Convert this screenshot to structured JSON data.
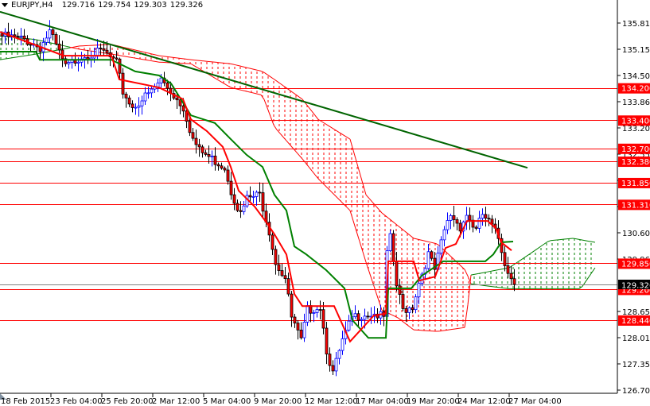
{
  "header": {
    "symbol": "EURJPY,H4",
    "open": "129.716",
    "high": "129.754",
    "low": "129.303",
    "close": "129.326"
  },
  "colors": {
    "bull": "#0000ff",
    "bear_body": "#ff0000",
    "bear_wick": "#000000",
    "tenkan": "#ff0000",
    "kijun": "#008000",
    "cloud_bear": "#ff0000",
    "cloud_bull": "#008000",
    "trendline": "#006400",
    "level": "#ff0000",
    "bid_line": "#808080"
  },
  "chart_data": {
    "type": "candlestick",
    "title": "EURJPY,H4",
    "ylim": [
      126.705,
      135.81
    ],
    "bar_interval": "H4",
    "y_ticks": [
      "135.810",
      "135.150",
      "134.505",
      "133.860",
      "133.200",
      "132.555",
      "131.915",
      "131.250",
      "130.605",
      "129.960",
      "128.655",
      "128.010",
      "127.350",
      "126.705"
    ],
    "x_ticks": [
      {
        "bar": 0,
        "label": "18 Feb 2015"
      },
      {
        "bar": 16,
        "label": "23 Feb 04:00"
      },
      {
        "bar": 32,
        "label": "25 Feb 20:00"
      },
      {
        "bar": 48,
        "label": "2 Mar 12:00"
      },
      {
        "bar": 64,
        "label": "5 Mar 04:00"
      },
      {
        "bar": 80,
        "label": "9 Mar 20:00"
      },
      {
        "bar": 96,
        "label": "12 Mar 12:00"
      },
      {
        "bar": 112,
        "label": "17 Mar 04:00"
      },
      {
        "bar": 128,
        "label": "19 Mar 20:00"
      },
      {
        "bar": 144,
        "label": "24 Mar 12:00"
      },
      {
        "bar": 160,
        "label": "27 Mar 04:00"
      }
    ],
    "close_path": [
      [
        0,
        135.49
      ],
      [
        7,
        135.4
      ],
      [
        12,
        135.2
      ],
      [
        15,
        135.59
      ],
      [
        20,
        134.71
      ],
      [
        25,
        135.0
      ],
      [
        32,
        135.1
      ],
      [
        36,
        134.8
      ],
      [
        38,
        134.11
      ],
      [
        41,
        133.72
      ],
      [
        47,
        134.11
      ],
      [
        50,
        134.41
      ],
      [
        54,
        134.02
      ],
      [
        57,
        133.72
      ],
      [
        60,
        132.93
      ],
      [
        62,
        132.64
      ],
      [
        66,
        132.44
      ],
      [
        70,
        132.24
      ],
      [
        72,
        131.65
      ],
      [
        75,
        131.06
      ],
      [
        77,
        131.45
      ],
      [
        81,
        131.55
      ],
      [
        84,
        130.66
      ],
      [
        86,
        129.88
      ],
      [
        89,
        129.48
      ],
      [
        91,
        128.5
      ],
      [
        94,
        127.91
      ],
      [
        96,
        128.69
      ],
      [
        100,
        128.79
      ],
      [
        102,
        127.71
      ],
      [
        104,
        127.12
      ],
      [
        107,
        127.91
      ],
      [
        110,
        128.5
      ],
      [
        114,
        128.6
      ],
      [
        117,
        128.6
      ],
      [
        120,
        128.5
      ],
      [
        121,
        130.07
      ],
      [
        122,
        130.47
      ],
      [
        124,
        129.29
      ],
      [
        126,
        128.69
      ],
      [
        129,
        128.79
      ],
      [
        131,
        129.38
      ],
      [
        134,
        130.07
      ],
      [
        136,
        129.68
      ],
      [
        139,
        130.66
      ],
      [
        141,
        131.06
      ],
      [
        144,
        130.76
      ],
      [
        146,
        131.06
      ],
      [
        149,
        130.66
      ],
      [
        151,
        131.06
      ],
      [
        154,
        130.76
      ],
      [
        156,
        130.47
      ],
      [
        158,
        129.88
      ],
      [
        160,
        129.48
      ],
      [
        161,
        129.33
      ]
    ],
    "tenkan": [
      [
        0,
        135.59
      ],
      [
        10,
        135.3
      ],
      [
        20,
        135.0
      ],
      [
        35,
        135.0
      ],
      [
        37.5,
        134.41
      ],
      [
        50,
        134.21
      ],
      [
        57.5,
        133.92
      ],
      [
        60,
        133.42
      ],
      [
        65,
        133.13
      ],
      [
        70,
        132.74
      ],
      [
        72.5,
        132.24
      ],
      [
        75,
        131.65
      ],
      [
        80,
        131.26
      ],
      [
        83.75,
        130.86
      ],
      [
        86.25,
        130.57
      ],
      [
        90,
        130.07
      ],
      [
        92.5,
        129.09
      ],
      [
        95,
        128.79
      ],
      [
        105,
        128.79
      ],
      [
        110,
        127.91
      ],
      [
        117.5,
        128.56
      ],
      [
        121.25,
        128.6
      ],
      [
        122,
        129.9
      ],
      [
        130,
        129.9
      ],
      [
        131.75,
        129.42
      ],
      [
        136.75,
        129.52
      ],
      [
        140,
        130.23
      ],
      [
        143.25,
        130.33
      ],
      [
        146.75,
        130.9
      ],
      [
        153.25,
        130.9
      ],
      [
        155.75,
        130.72
      ],
      [
        157.5,
        130.37
      ],
      [
        160.75,
        130.17
      ]
    ],
    "kijun": [
      [
        0,
        135.1
      ],
      [
        11.25,
        135.1
      ],
      [
        12.5,
        134.9
      ],
      [
        35,
        134.9
      ],
      [
        42.5,
        134.61
      ],
      [
        50,
        134.51
      ],
      [
        53.75,
        134.31
      ],
      [
        60,
        133.52
      ],
      [
        67.5,
        133.33
      ],
      [
        72.5,
        132.93
      ],
      [
        77.5,
        132.54
      ],
      [
        82.5,
        132.24
      ],
      [
        86.25,
        131.55
      ],
      [
        90,
        131.16
      ],
      [
        92.5,
        130.27
      ],
      [
        96.25,
        130.07
      ],
      [
        102.5,
        129.68
      ],
      [
        108.25,
        129.23
      ],
      [
        110.75,
        128.44
      ],
      [
        115.75,
        128.0
      ],
      [
        121.25,
        128.0
      ],
      [
        122,
        129.23
      ],
      [
        129.25,
        129.23
      ],
      [
        132.5,
        129.54
      ],
      [
        139.25,
        129.9
      ],
      [
        152.5,
        129.9
      ],
      [
        155,
        130.07
      ],
      [
        157.5,
        130.37
      ],
      [
        161.25,
        130.39
      ]
    ],
    "span_a": [
      [
        0,
        135.49
      ],
      [
        11.25,
        135.4
      ],
      [
        25,
        135.16
      ],
      [
        35,
        135.04
      ],
      [
        50,
        134.84
      ],
      [
        60,
        134.8
      ],
      [
        72.5,
        134.21
      ],
      [
        82.5,
        134.02
      ],
      [
        86.25,
        133.23
      ],
      [
        95,
        132.44
      ],
      [
        100,
        131.95
      ],
      [
        110,
        131.16
      ],
      [
        115,
        129.88
      ],
      [
        120,
        128.69
      ],
      [
        125,
        128.5
      ],
      [
        130,
        128.2
      ],
      [
        137.5,
        128.16
      ],
      [
        146.25,
        128.26
      ],
      [
        148,
        129.56
      ],
      [
        160,
        129.74
      ],
      [
        166.25,
        130.07
      ],
      [
        172.5,
        130.41
      ],
      [
        180,
        130.47
      ],
      [
        187,
        130.37
      ]
    ],
    "span_b": [
      [
        0,
        134.9
      ],
      [
        11.25,
        135.04
      ],
      [
        25,
        135.24
      ],
      [
        35,
        135.28
      ],
      [
        50,
        135.0
      ],
      [
        60,
        134.9
      ],
      [
        72.5,
        134.8
      ],
      [
        82.5,
        134.61
      ],
      [
        86.25,
        134.41
      ],
      [
        95,
        133.92
      ],
      [
        100,
        133.42
      ],
      [
        110,
        132.93
      ],
      [
        115,
        131.55
      ],
      [
        120,
        131.1
      ],
      [
        130,
        130.47
      ],
      [
        137.5,
        130.33
      ],
      [
        146.25,
        129.68
      ],
      [
        148,
        129.34
      ],
      [
        160,
        129.22
      ],
      [
        182.5,
        129.22
      ],
      [
        187,
        129.74
      ]
    ],
    "trendline": [
      [
        0,
        136.09
      ],
      [
        165.75,
        132.22
      ]
    ],
    "levels": [
      "134.200",
      "133.400",
      "132.700",
      "132.380",
      "131.850",
      "131.310",
      "129.850",
      "129.200",
      "128.440"
    ],
    "bid": "129.326"
  }
}
